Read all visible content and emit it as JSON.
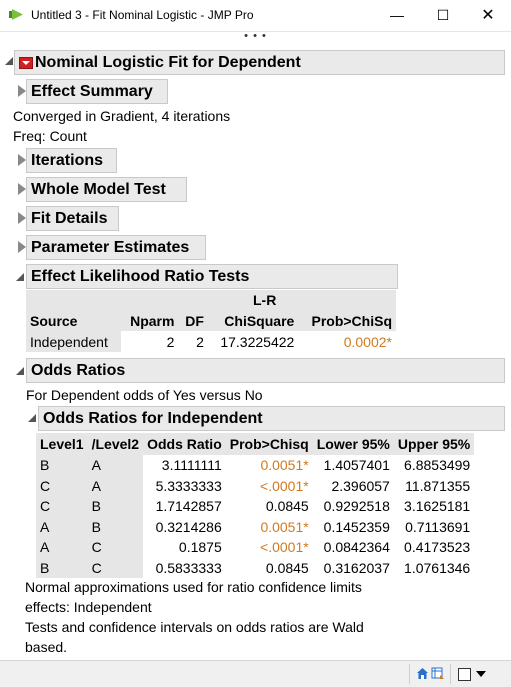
{
  "window": {
    "title": "Untitled 3 - Fit Nominal Logistic - JMP Pro",
    "more_label": "• • •"
  },
  "report": {
    "title": "Nominal Logistic Fit for Dependent",
    "effect_summary": "Effect Summary",
    "converged": "Converged in Gradient, 4 iterations",
    "freq": "Freq: Count",
    "sections": [
      "Iterations",
      "Whole Model Test",
      "Fit Details",
      "Parameter Estimates"
    ],
    "lr_tests": {
      "title": "Effect Likelihood Ratio Tests",
      "headers": {
        "source": "Source",
        "nparm": "Nparm",
        "df": "DF",
        "lr_top": "L-R",
        "chisquare": "ChiSquare",
        "prob": "Prob>ChiSq"
      },
      "row": {
        "source": "Independent",
        "nparm": "2",
        "df": "2",
        "chisquare": "17.3225422",
        "prob": "0.0002*"
      }
    },
    "odds": {
      "title": "Odds Ratios",
      "subtitle": "For Dependent odds of Yes versus No",
      "sub_title": "Odds Ratios for Independent",
      "headers": [
        "Level1",
        "/Level2",
        "Odds Ratio",
        "Prob>Chisq",
        "Lower 95%",
        "Upper 95%"
      ],
      "rows": [
        [
          "B",
          "A",
          "3.1111111",
          "0.0051*",
          "1.4057401",
          "6.8853499"
        ],
        [
          "C",
          "A",
          "5.3333333",
          "<.0001*",
          "2.396057",
          "11.871355"
        ],
        [
          "C",
          "B",
          "1.7142857",
          "0.0845",
          "0.9292518",
          "3.1625181"
        ],
        [
          "A",
          "B",
          "0.3214286",
          "0.0051*",
          "0.1452359",
          "0.7113691"
        ],
        [
          "A",
          "C",
          "0.1875",
          "<.0001*",
          "0.0842364",
          "0.4173523"
        ],
        [
          "B",
          "C",
          "0.5833333",
          "0.0845",
          "0.3162037",
          "1.0761346"
        ]
      ],
      "note1": "Normal approximations used for ratio confidence limits",
      "note2": "effects: Independent",
      "note3": "Tests and confidence intervals on odds ratios are Wald",
      "note4": "based."
    }
  },
  "colors": {
    "significant": "#d07a1f",
    "header_bg": "#eaeaea",
    "red_menu": "#cc2222"
  }
}
